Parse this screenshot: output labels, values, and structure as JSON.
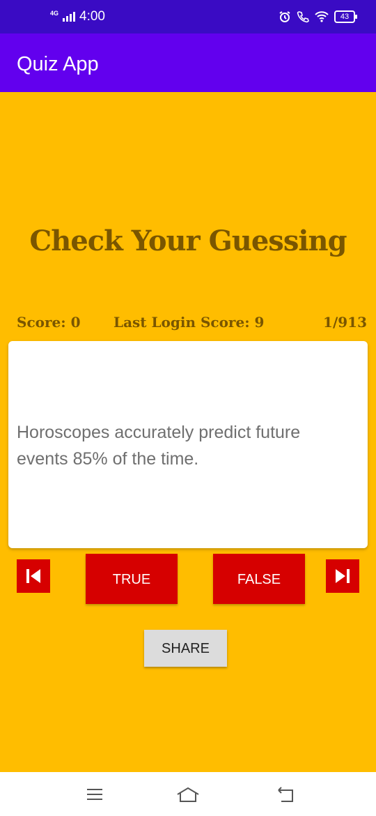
{
  "status_bar": {
    "network": "4G",
    "time": "4:00",
    "battery": "43"
  },
  "app_bar": {
    "title": "Quiz App"
  },
  "quiz": {
    "headline": "Check Your Guessing",
    "score": "Score: 0",
    "last_login_score": "Last Login Score: 9",
    "progress": "1/913",
    "question": "Horoscopes accurately predict future events 85% of the time.",
    "true_label": "TRUE",
    "false_label": "FALSE",
    "share_label": "SHARE"
  },
  "icons": {
    "prev": "skip-previous-icon",
    "next": "skip-next-icon",
    "alarm": "alarm-icon",
    "call": "wifi-call-icon",
    "wifi": "wifi-icon",
    "nav_menu": "menu-icon",
    "nav_home": "home-icon",
    "nav_back": "back-icon"
  },
  "colors": {
    "status_bar": "#3A0BC4",
    "app_bar": "#6200EE",
    "background": "#FFBD00",
    "headline": "#7A5600",
    "button_red": "#D60000",
    "share_button": "#DCDCDC"
  }
}
